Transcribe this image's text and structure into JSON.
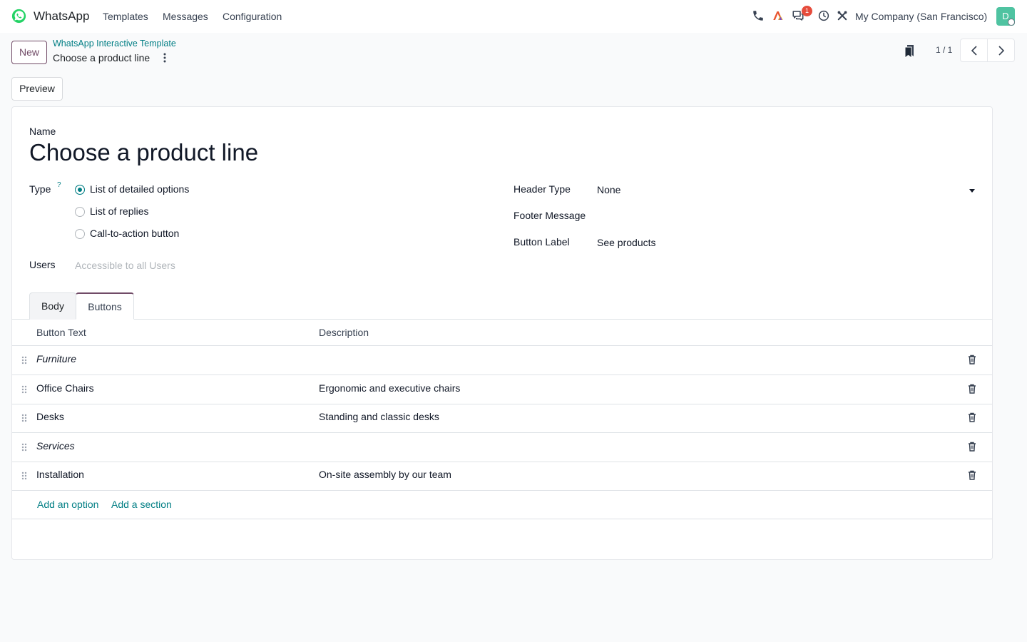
{
  "navbar": {
    "app_name": "WhatsApp",
    "menu": [
      "Templates",
      "Messages",
      "Configuration"
    ],
    "badge_count": "1",
    "company": "My Company (San Francisco)",
    "avatar_letter": "D"
  },
  "control_panel": {
    "new_label": "New",
    "breadcrumb_parent": "WhatsApp Interactive Template",
    "breadcrumb_current": "Choose a product line",
    "pager": "1 / 1",
    "preview_label": "Preview"
  },
  "form": {
    "name_label": "Name",
    "title": "Choose a product line",
    "type_label": "Type",
    "help_mark": "?",
    "type_options": [
      {
        "label": "List of detailed options",
        "selected": true
      },
      {
        "label": "List of replies",
        "selected": false
      },
      {
        "label": "Call-to-action button",
        "selected": false
      }
    ],
    "users_label": "Users",
    "users_placeholder": "Accessible to all Users",
    "header_type_label": "Header Type",
    "header_type_value": "None",
    "footer_label": "Footer Message",
    "button_label_label": "Button Label",
    "button_label_value": "See products"
  },
  "tabs": [
    "Body",
    "Buttons"
  ],
  "active_tab": "Buttons",
  "table": {
    "columns": [
      "Button Text",
      "Description"
    ],
    "rows": [
      {
        "text": "Furniture",
        "description": "",
        "is_section": true
      },
      {
        "text": "Office Chairs",
        "description": "Ergonomic and executive chairs",
        "is_section": false
      },
      {
        "text": "Desks",
        "description": "Standing and classic desks",
        "is_section": false
      },
      {
        "text": "Services",
        "description": "",
        "is_section": true
      },
      {
        "text": "Installation",
        "description": "On-site assembly by our team",
        "is_section": false
      }
    ],
    "add_option": "Add an option",
    "add_section": "Add a section"
  },
  "colors": {
    "accent": "#714b67",
    "link": "#017e84",
    "badge": "#e64c3c",
    "logo": "#25d366"
  }
}
